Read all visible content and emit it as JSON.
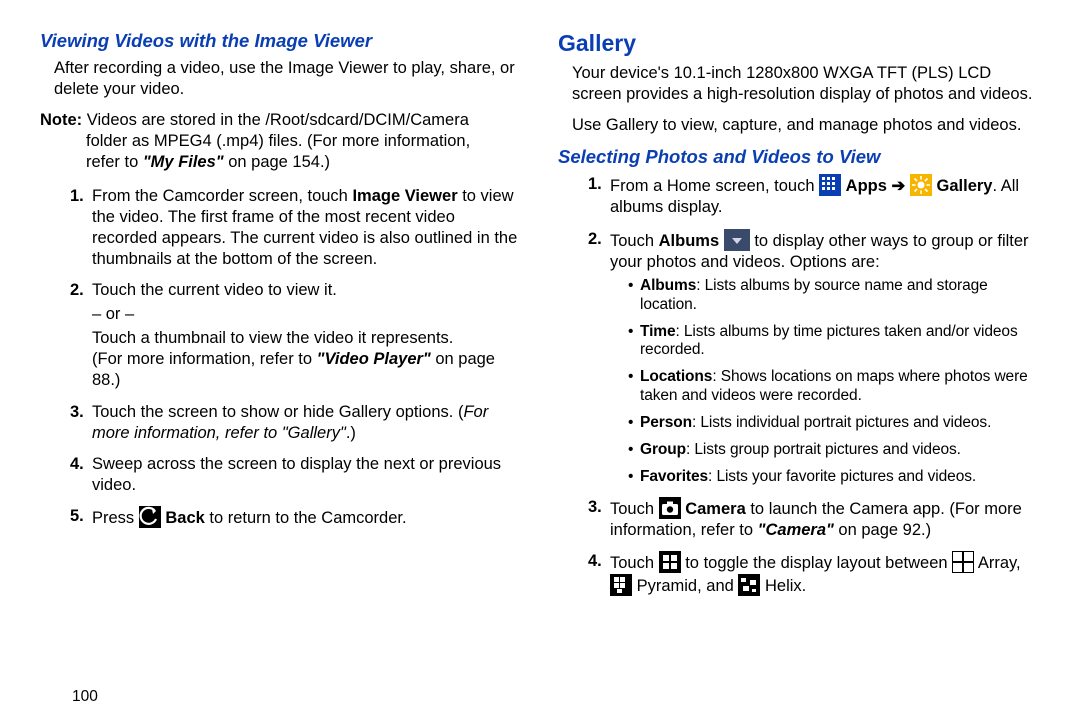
{
  "left": {
    "subheading": "Viewing Videos with the Image Viewer",
    "intro": "After recording a video, use the Image Viewer to play, share, or delete your video.",
    "note_label": "Note:",
    "note_line1": "Videos are stored in the /Root/sdcard/DCIM/Camera",
    "note_line2": "folder as MPEG4 (.mp4) files. (For more information,",
    "note_line3a": "refer to ",
    "note_myfiles": "\"My Files\"",
    "note_line3b": " on page 154.)",
    "s1_a": "From the Camcorder screen, touch ",
    "s1_b": "Image Viewer",
    "s1_c": " to view the video. The first frame of the most recent video recorded appears. The current video is also outlined in the thumbnails at the bottom of the screen.",
    "s2_a": "Touch the current video to view it.",
    "s2_or": "– or –",
    "s2_b": "Touch a thumbnail to view the video it represents.",
    "s2_c1": "(For more information, refer to ",
    "s2_vp": "\"Video Player\"",
    "s2_c2": " on page 88.)",
    "s3_a": "Touch the screen to show or hide Gallery options. (",
    "s3_i": "For more information, refer to \"Gallery\"",
    "s3_b": ".)",
    "s4": "Sweep across the screen to display the next or previous video.",
    "s5_a": "Press ",
    "s5_back": "Back",
    "s5_b": " to return to the Camcorder."
  },
  "right": {
    "heading": "Gallery",
    "intro1": "Your device's 10.1-inch 1280x800 WXGA TFT (PLS) LCD screen provides a high-resolution display of photos and videos.",
    "intro2": "Use Gallery to view, capture, and manage photos and videos.",
    "subheading": "Selecting Photos and Videos to View",
    "s1_a": "From a Home screen, touch ",
    "s1_apps": "Apps",
    "s1_gallery": "Gallery",
    "s1_b": ". All albums display.",
    "s2_a": "Touch ",
    "s2_albums": "Albums",
    "s2_b": " to display other ways to group or filter your photos and videos. Options are:",
    "bul_albums_b": "Albums",
    "bul_albums_t": ": Lists albums by source name and storage location.",
    "bul_time_b": "Time",
    "bul_time_t": ": Lists albums by time pictures taken and/or videos recorded.",
    "bul_loc_b": "Locations",
    "bul_loc_t": ": Shows locations on maps where photos were taken and videos were recorded.",
    "bul_person_b": "Person",
    "bul_person_t": ": Lists individual portrait pictures and videos.",
    "bul_group_b": "Group",
    "bul_group_t": ": Lists group portrait pictures and videos.",
    "bul_fav_b": "Favorites",
    "bul_fav_t": ": Lists your favorite pictures and videos.",
    "s3_a": "Touch ",
    "s3_camera": "Camera",
    "s3_b": " to launch the Camera app. (For more information, refer to ",
    "s3_ref": "\"Camera\"",
    "s3_c": " on page 92.)",
    "s4_a": "Touch ",
    "s4_b": " to toggle the display layout between ",
    "s4_array": " Array, ",
    "s4_pyr": " Pyramid, and ",
    "s4_helix": " Helix."
  },
  "pagenum": "100"
}
